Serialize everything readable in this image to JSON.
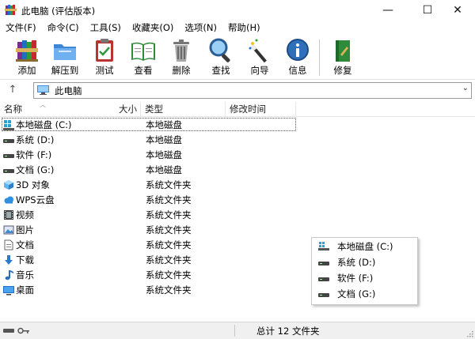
{
  "window": {
    "title": "此电脑 (评估版本)",
    "controls": {
      "minimize": "—",
      "maximize": "☐",
      "close": "✕"
    }
  },
  "menu": [
    "文件(F)",
    "命令(C)",
    "工具(S)",
    "收藏夹(O)",
    "选项(N)",
    "帮助(H)"
  ],
  "toolbar": [
    {
      "label": "添加",
      "icon": "books-add-icon"
    },
    {
      "label": "解压到",
      "icon": "folder-extract-icon"
    },
    {
      "label": "测试",
      "icon": "clipboard-test-icon"
    },
    {
      "label": "查看",
      "icon": "book-view-icon"
    },
    {
      "label": "删除",
      "icon": "trash-icon"
    },
    {
      "label": "查找",
      "icon": "magnifier-icon"
    },
    {
      "label": "向导",
      "icon": "magic-wand-icon"
    },
    {
      "label": "信息",
      "icon": "info-icon"
    },
    {
      "label": "修复",
      "icon": "repair-book-icon"
    }
  ],
  "address": {
    "up_symbol": "↑",
    "path": "此电脑",
    "dropdown_symbol": "⌄"
  },
  "columns": {
    "name": "名称",
    "size": "大小",
    "type": "类型",
    "modified": "修改时间"
  },
  "files": [
    {
      "name": "本地磁盘 (C:)",
      "type": "本地磁盘",
      "icon": "windows-drive-icon"
    },
    {
      "name": "系统 (D:)",
      "type": "本地磁盘",
      "icon": "drive-icon"
    },
    {
      "name": "软件 (F:)",
      "type": "本地磁盘",
      "icon": "drive-icon"
    },
    {
      "name": "文档 (G:)",
      "type": "本地磁盘",
      "icon": "drive-icon"
    },
    {
      "name": "3D 对象",
      "type": "系统文件夹",
      "icon": "cube-3d-icon"
    },
    {
      "name": "WPS云盘",
      "type": "系统文件夹",
      "icon": "cloud-icon"
    },
    {
      "name": "视频",
      "type": "系统文件夹",
      "icon": "film-icon"
    },
    {
      "name": "图片",
      "type": "系统文件夹",
      "icon": "picture-icon"
    },
    {
      "name": "文档",
      "type": "系统文件夹",
      "icon": "document-icon"
    },
    {
      "name": "下载",
      "type": "系统文件夹",
      "icon": "download-arrow-icon"
    },
    {
      "name": "音乐",
      "type": "系统文件夹",
      "icon": "music-note-icon"
    },
    {
      "name": "桌面",
      "type": "系统文件夹",
      "icon": "desktop-icon"
    }
  ],
  "drive_popup": [
    {
      "label": "本地磁盘 (C:)",
      "icon": "windows-drive-icon"
    },
    {
      "label": "系统 (D:)",
      "icon": "drive-icon"
    },
    {
      "label": "软件 (F:)",
      "icon": "drive-icon"
    },
    {
      "label": "文档 (G:)",
      "icon": "drive-icon"
    }
  ],
  "status": {
    "summary": "总计 12 文件夹"
  },
  "colors": {
    "selection_accent": "#0078d7",
    "status_bg": "#f0f0f0"
  }
}
